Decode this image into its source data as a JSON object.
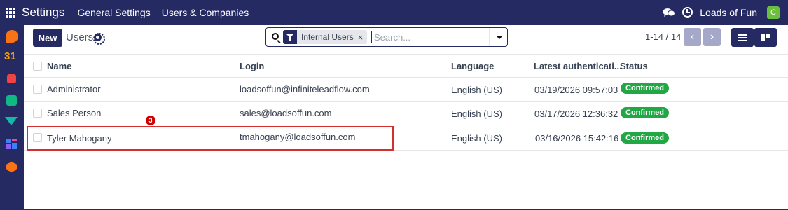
{
  "topbar": {
    "app_title": "Settings",
    "nav": [
      "General Settings",
      "Users & Companies"
    ],
    "company": "Loads of Fun",
    "avatar_letter": "C"
  },
  "sidebar": {
    "calendar_label": "31"
  },
  "control": {
    "new_label": "New",
    "title": "Users",
    "facet_label": "Internal Users",
    "facet_close": "×",
    "search_placeholder": "Search...",
    "pager": "1-14 / 14",
    "prev": "‹",
    "next": "›"
  },
  "table": {
    "columns": [
      "Name",
      "Login",
      "Language",
      "Latest authenticati...",
      "Status"
    ],
    "rows": [
      {
        "name": "Administrator",
        "login": "loadsoffun@infiniteleadflow.com",
        "language": "English (US)",
        "auth": "03/19/2026 09:57:03",
        "status": "Confirmed"
      },
      {
        "name": "Sales Person",
        "login": "sales@loadsoffun.com",
        "language": "English (US)",
        "auth": "03/17/2026 12:36:32",
        "status": "Confirmed"
      },
      {
        "name": "Tyler Mahogany",
        "login": "tmahogany@loadsoffun.com",
        "language": "English (US)",
        "auth": "03/16/2026 15:42:16",
        "status": "Confirmed"
      }
    ]
  },
  "annotation": {
    "step": "3"
  },
  "colors": {
    "brand": "#252a63",
    "confirmed": "#22a745",
    "highlight": "#d32f2f"
  },
  "icons": [
    "apps-grid-icon",
    "chat-icon",
    "clock-icon",
    "discuss-icon",
    "calendar-icon",
    "todo-icon",
    "contacts-icon",
    "crm-icon",
    "dashboard-icon",
    "apps-icon",
    "gear-icon",
    "search-icon",
    "filter-icon",
    "chevron-down-icon",
    "list-view-icon",
    "kanban-view-icon"
  ]
}
